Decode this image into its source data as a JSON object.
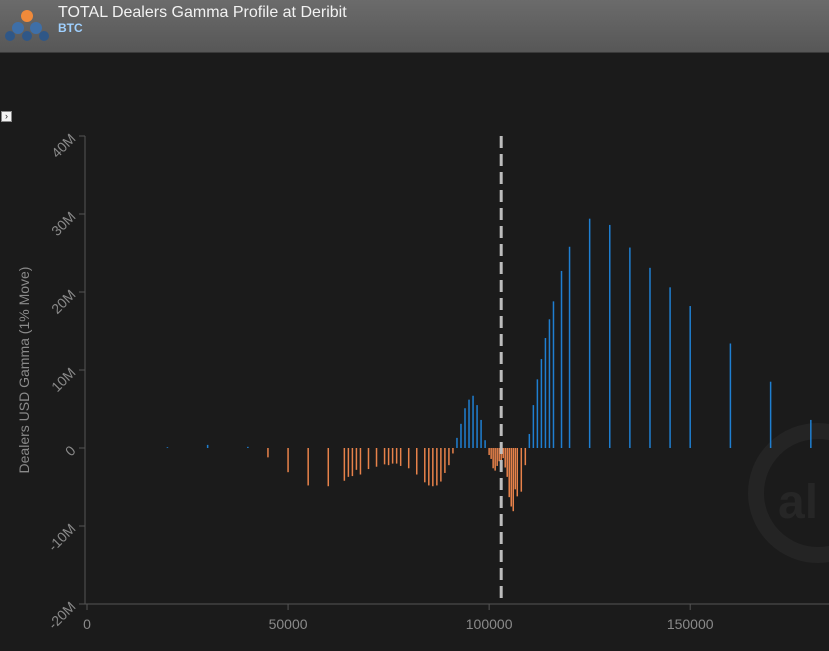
{
  "header": {
    "title": "TOTAL Dealers Gamma Profile at Deribit",
    "subtitle": "BTC"
  },
  "controls": {
    "expand_label": "›"
  },
  "watermark": {
    "text": "al"
  },
  "colors": {
    "positive": "#1f7fd1",
    "negative": "#e8824a",
    "spot_line": "#bdbdbd",
    "axis": "#555555",
    "tick_text": "#8a8a8a"
  },
  "chart_data": {
    "type": "bar",
    "title": "TOTAL Dealers Gamma Profile at Deribit",
    "subtitle": "BTC",
    "ylabel": "Dealers USD Gamma (1% Move)",
    "xlabel": "",
    "xlim": [
      0,
      188000
    ],
    "ylim": [
      -20000000,
      40000000
    ],
    "x_ticks": [
      0,
      50000,
      100000,
      150000
    ],
    "x_tick_labels": [
      "0",
      "50000",
      "100000",
      "150000"
    ],
    "y_ticks": [
      -20000000,
      -10000000,
      0,
      10000000,
      20000000,
      30000000,
      40000000
    ],
    "y_tick_labels": [
      "-20M",
      "-10M",
      "0",
      "10M",
      "20M",
      "30M",
      "40M"
    ],
    "spot_price": 103000,
    "grid": false,
    "series": [
      {
        "points": [
          [
            20000,
            100000
          ],
          [
            30000,
            400000
          ],
          [
            40000,
            150000
          ],
          [
            45000,
            -1200000
          ],
          [
            50000,
            -3100000
          ],
          [
            55000,
            -4800000
          ],
          [
            60000,
            -4900000
          ],
          [
            64000,
            -4200000
          ],
          [
            65000,
            -3700000
          ],
          [
            66000,
            -3600000
          ],
          [
            67000,
            -2800000
          ],
          [
            68000,
            -3400000
          ],
          [
            70000,
            -2700000
          ],
          [
            72000,
            -2400000
          ],
          [
            74000,
            -2100000
          ],
          [
            75000,
            -2200000
          ],
          [
            76000,
            -2000000
          ],
          [
            77000,
            -2000000
          ],
          [
            78000,
            -2300000
          ],
          [
            80000,
            -2600000
          ],
          [
            82000,
            -3400000
          ],
          [
            84000,
            -4400000
          ],
          [
            85000,
            -4800000
          ],
          [
            86000,
            -4900000
          ],
          [
            87000,
            -4800000
          ],
          [
            88000,
            -4300000
          ],
          [
            89000,
            -3200000
          ],
          [
            90000,
            -2200000
          ],
          [
            91000,
            -700000
          ],
          [
            92000,
            1300000
          ],
          [
            93000,
            3100000
          ],
          [
            94000,
            5100000
          ],
          [
            95000,
            6200000
          ],
          [
            96000,
            6700000
          ],
          [
            97000,
            5500000
          ],
          [
            98000,
            3600000
          ],
          [
            99000,
            1000000
          ],
          [
            100000,
            -900000
          ],
          [
            100500,
            -1400000
          ],
          [
            101000,
            -2600000
          ],
          [
            101500,
            -2900000
          ],
          [
            102000,
            -2300000
          ],
          [
            102500,
            -1700000
          ],
          [
            103000,
            -1800000
          ],
          [
            103500,
            -1300000
          ],
          [
            104000,
            -2500000
          ],
          [
            104500,
            -3700000
          ],
          [
            105000,
            -6300000
          ],
          [
            105500,
            -7500000
          ],
          [
            106000,
            -8100000
          ],
          [
            106500,
            -5300000
          ],
          [
            107000,
            -6200000
          ],
          [
            108000,
            -5600000
          ],
          [
            109000,
            -2200000
          ],
          [
            110000,
            1800000
          ],
          [
            111000,
            5500000
          ],
          [
            112000,
            8800000
          ],
          [
            113000,
            11400000
          ],
          [
            114000,
            14100000
          ],
          [
            115000,
            16500000
          ],
          [
            116000,
            18800000
          ],
          [
            118000,
            22700000
          ],
          [
            120000,
            25800000
          ],
          [
            125000,
            29400000
          ],
          [
            130000,
            28600000
          ],
          [
            135000,
            25700000
          ],
          [
            140000,
            23100000
          ],
          [
            145000,
            20600000
          ],
          [
            150000,
            18200000
          ],
          [
            160000,
            13400000
          ],
          [
            170000,
            8500000
          ],
          [
            180000,
            3600000
          ]
        ]
      }
    ]
  }
}
